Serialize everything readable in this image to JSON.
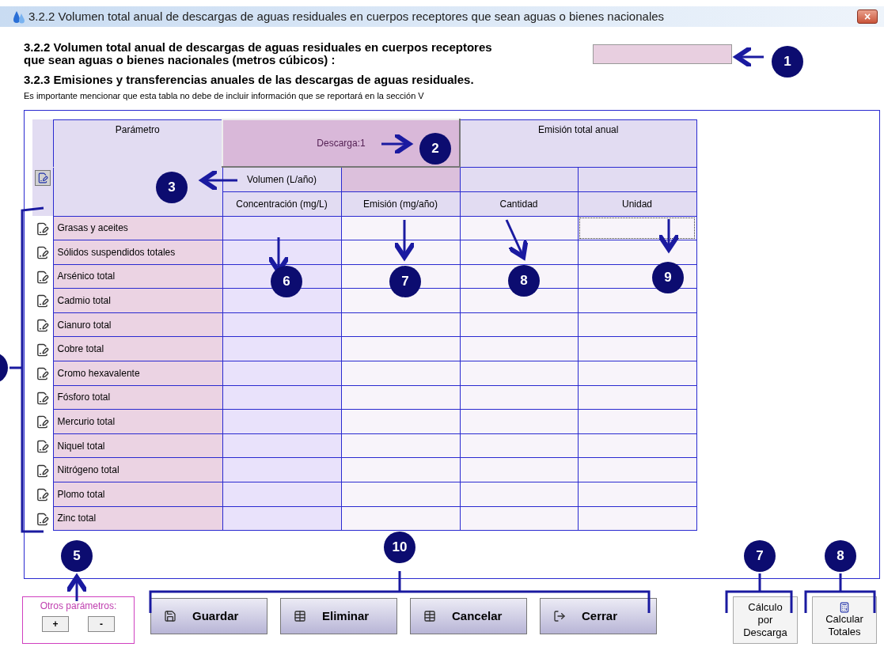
{
  "window": {
    "title": "3.2.2 Volumen total anual de descargas de aguas residuales en cuerpos receptores que sean aguas o bienes nacionales",
    "close": "×"
  },
  "volume_field": {
    "label": "3.2.2 Volumen total anual de descargas de aguas residuales en cuerpos receptores que sean aguas o bienes nacionales (metros cúbicos) :"
  },
  "section": {
    "title": "3.2.3 Emisiones y transferencias anuales de las descargas de aguas residuales.",
    "note": "Es importante mencionar que esta tabla no debe de incluir información que se reportará en la sección V"
  },
  "table": {
    "parameter_header": "Parámetro",
    "discharge_header": "Descarga:1",
    "total_header": "Emisión total anual",
    "volume_header": "Volumen (L/año)",
    "columns": [
      "Concentración (mg/L)",
      "Emisión (mg/año)",
      "Cantidad",
      "Unidad"
    ],
    "rows": [
      {
        "name": "Grasas y aceites",
        "focused": true
      },
      {
        "name": "Sólidos suspendidos totales",
        "focused": false
      },
      {
        "name": "Arsénico total",
        "focused": false
      },
      {
        "name": "Cadmio total",
        "focused": false
      },
      {
        "name": "Cianuro total",
        "focused": false
      },
      {
        "name": "Cobre total",
        "focused": false
      },
      {
        "name": "Cromo hexavalente",
        "focused": false
      },
      {
        "name": "Fósforo total",
        "focused": false
      },
      {
        "name": "Mercurio total",
        "focused": false
      },
      {
        "name": "Niquel total",
        "focused": false
      },
      {
        "name": "Nitrógeno total",
        "focused": false
      },
      {
        "name": "Plomo total",
        "focused": false
      },
      {
        "name": "Zinc total",
        "focused": false
      }
    ]
  },
  "other_parameters": {
    "label": "Otros parámetros:",
    "buttons": [
      "+",
      "-"
    ]
  },
  "buttons": [
    {
      "label": "Guardar",
      "kind": "save"
    },
    {
      "label": "Eliminar",
      "kind": "delete"
    },
    {
      "label": "Cancelar",
      "kind": "cancel"
    },
    {
      "label": "Cerrar",
      "kind": "close"
    }
  ],
  "side_buttons": [
    {
      "label": "Cálculo por Descarga",
      "kind": "text"
    },
    {
      "label": "Calcular Totales",
      "kind": "calculator"
    }
  ],
  "callouts": [
    {
      "label": "1"
    },
    {
      "label": "2"
    },
    {
      "label": "3"
    },
    {
      "label": "6"
    },
    {
      "label": "7"
    },
    {
      "label": "8"
    },
    {
      "label": "9"
    },
    {
      "label": "5"
    },
    {
      "label": "10"
    },
    {
      "label": "7"
    },
    {
      "label": "8"
    }
  ]
}
